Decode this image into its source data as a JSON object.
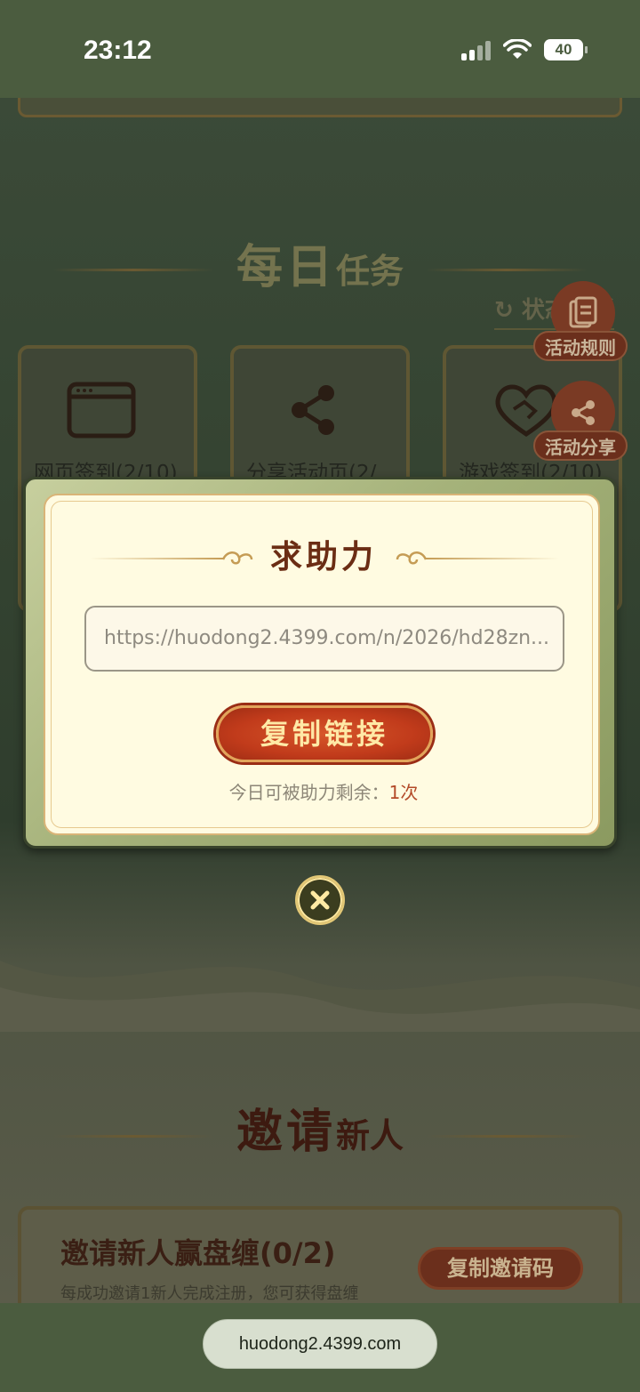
{
  "status_bar": {
    "time": "23:12",
    "battery": "40"
  },
  "daily_tasks": {
    "title_big": "每日",
    "title_small": "任务",
    "refresh_label": "状态刷新",
    "cards": [
      {
        "label": "网页签到(2/10)",
        "icon": "browser-window-icon"
      },
      {
        "label": "分享活动页(2/...",
        "icon": "share-icon"
      },
      {
        "label": "游戏签到(2/10)",
        "icon": "heart-handshake-icon"
      }
    ]
  },
  "side_buttons": {
    "rules_label": "活动规则",
    "share_label": "活动分享"
  },
  "modal": {
    "title": "求助力",
    "link_value": "https://huodong2.4399.com/n/2026/hd28zn...",
    "copy_button_label": "复制链接",
    "remaining_prefix": "今日可被助力剩余：",
    "remaining_count": "1次"
  },
  "invite": {
    "title_big": "邀请",
    "title_small": "新人",
    "card_title": "邀请新人赢盘缠(0/2)",
    "card_desc": "每成功邀请1新人完成注册，您可获得盘缠",
    "copy_code_label": "复制邀请码"
  },
  "url_bar": {
    "domain": "huodong2.4399.com"
  },
  "colors": {
    "primary_red": "#c13b1b",
    "gold": "#e2a45a",
    "panel_cream": "#fffbe1",
    "dark_green": "#4b5c3f"
  }
}
